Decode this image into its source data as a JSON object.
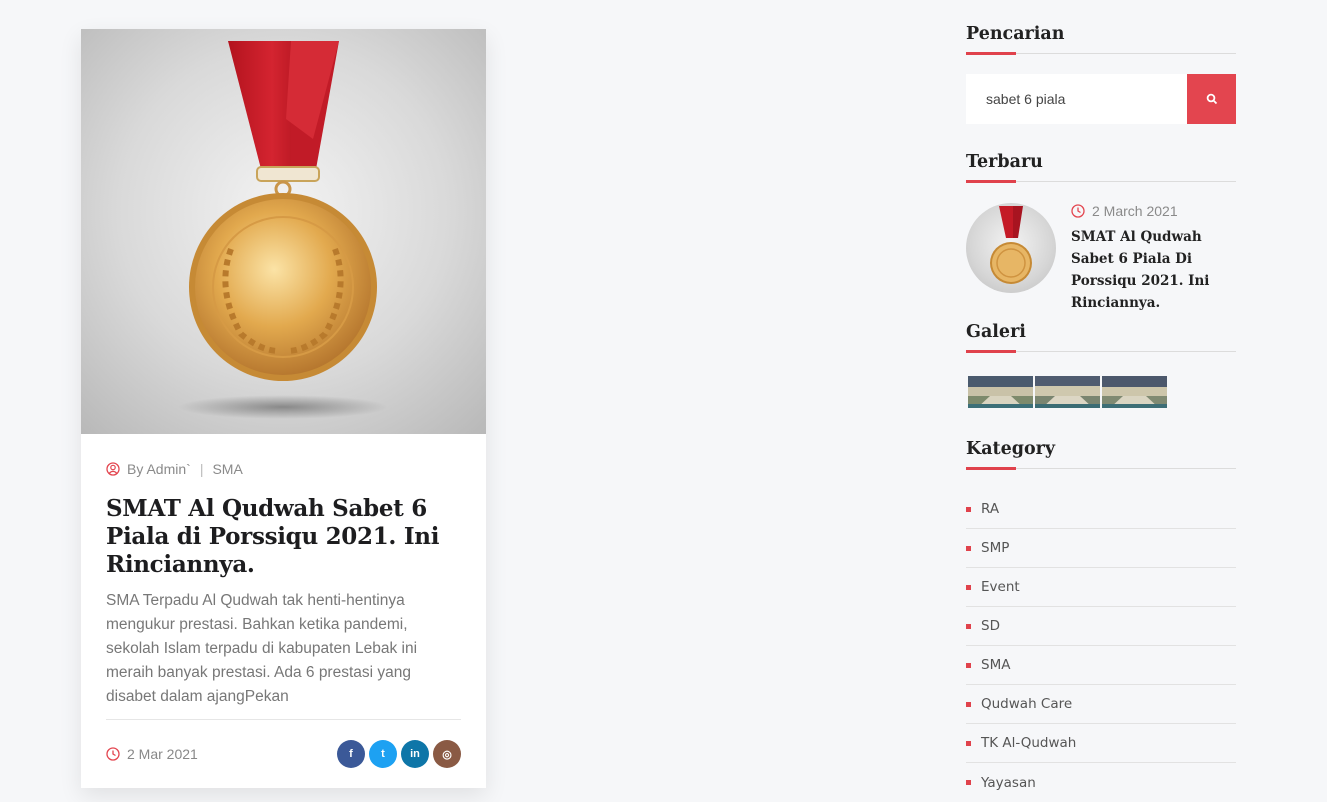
{
  "post": {
    "author": "By Admin`",
    "category": "SMA",
    "title": "SMAT Al Qudwah Sabet 6 Piala di Porssiqu 2021. Ini Rinciannya.",
    "excerpt": "SMA Terpadu Al Qudwah tak henti-hentinya mengukur prestasi. Bahkan ketika pandemi, sekolah Islam terpadu di kabupaten Lebak ini meraih banyak prestasi. Ada 6 prestasi yang disabet dalam ajangPekan",
    "date": "2 Mar 2021",
    "socials": [
      {
        "name": "facebook",
        "glyph": "f",
        "color": "#3b5998"
      },
      {
        "name": "twitter",
        "glyph": "t",
        "color": "#1da1f2"
      },
      {
        "name": "linkedin",
        "glyph": "in",
        "color": "#0e76a8"
      },
      {
        "name": "instagram",
        "glyph": "◎",
        "color": "#8a5a44"
      }
    ]
  },
  "sidebar": {
    "search": {
      "title": "Pencarian",
      "value": "sabet 6 piala",
      "button_icon": "search-icon"
    },
    "recent": {
      "title": "Terbaru",
      "date": "2 March 2021",
      "post_title": "SMAT Al Qudwah Sabet 6 Piala Di Porssiqu 2021. Ini Rinciannya."
    },
    "gallery": {
      "title": "Galeri"
    },
    "categories": {
      "title": "Kategory",
      "items": [
        "RA",
        "SMP",
        "Event",
        "SD",
        "SMA",
        "Qudwah Care",
        "TK Al-Qudwah",
        "Yayasan"
      ]
    }
  },
  "colors": {
    "accent": "#e3454f",
    "background": "#f6f7f9"
  }
}
